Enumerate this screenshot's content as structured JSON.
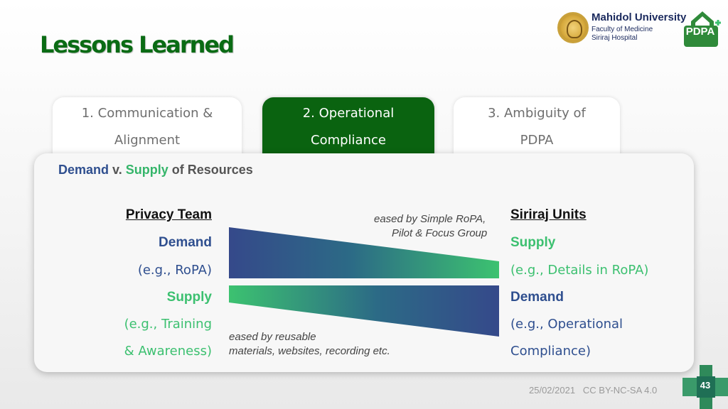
{
  "slide": {
    "title": "Lessons Learned",
    "colors": {
      "title_green": "#0a6b14",
      "active_tab": "#0a6310",
      "demand_blue": "#2f4f8f",
      "supply_green": "#3cc070"
    }
  },
  "logo": {
    "university": "Mahidol University",
    "line1": "Faculty of Medicine",
    "line2": "Siriraj Hospital",
    "badge": "PDPA"
  },
  "tabs": [
    {
      "line1": "1. Communication &",
      "line2": "Alignment",
      "active": false
    },
    {
      "line1": "2. Operational",
      "line2": "Compliance",
      "active": true
    },
    {
      "line1": "3. Ambiguity of",
      "line2": "PDPA",
      "active": false
    }
  ],
  "card": {
    "heading": {
      "demand": "Demand",
      "v": " v. ",
      "supply": "Supply",
      "rest": " of Resources"
    },
    "left": {
      "team": "Privacy Team",
      "demand": "Demand",
      "demand_ex": "(e.g., RoPA)",
      "supply": "Supply",
      "supply_ex1": "(e.g., Training",
      "supply_ex2": "& Awareness)"
    },
    "right": {
      "team": "Siriraj Units",
      "supply": "Supply",
      "supply_ex": "(e.g., Details in RoPA)",
      "demand": "Demand",
      "demand_ex1": "(e.g., Operational",
      "demand_ex2": "Compliance)"
    },
    "note_top1": "eased by Simple RoPA,",
    "note_top2": "Pilot & Focus Group",
    "note_bottom1": "eased by reusable",
    "note_bottom2": "materials, websites, recording etc."
  },
  "footer": {
    "date": "25/02/2021",
    "license": "CC BY-NC-SA 4.0",
    "page": "43"
  }
}
